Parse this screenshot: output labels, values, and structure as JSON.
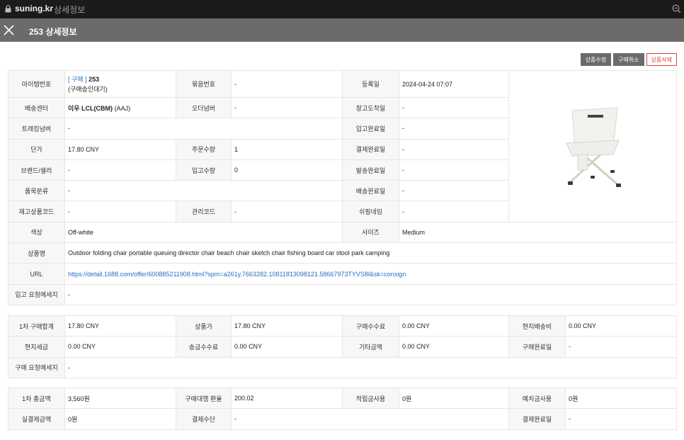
{
  "browser": {
    "host": "suning.kr",
    "subtitle": "상세정보"
  },
  "header": {
    "title": "253 상세정보"
  },
  "actions": {
    "edit": "상품수정",
    "cancel": "구매취소",
    "delete": "상품삭제"
  },
  "colors": {
    "header_bg": "#6b6b6b",
    "link": "#2b6cc4",
    "danger": "#e0453a"
  },
  "product": {
    "item_no_label": "아이템번호",
    "item_tag": "[ 구매 ]",
    "item_no": "253",
    "item_status": "(구매승인대기)",
    "bundle_label": "묶음번호",
    "bundle": "-",
    "reg_date_label": "등록일",
    "reg_date": "2024-04-24 07:07",
    "center_label": "배송센터",
    "center_name": "이우 LCL(CBM)",
    "center_code": "(AAJ)",
    "order_no_label": "오더넘버",
    "order_no": "-",
    "warehouse_arrival_label": "창고도착일",
    "warehouse_arrival": "-",
    "tracking_label": "트래킹넘버",
    "tracking": "-",
    "inbound_done_label": "입고완료일",
    "inbound_done": "-",
    "unit_price_label": "단가",
    "unit_price": "17.80 CNY",
    "order_qty_label": "주문수량",
    "order_qty": "1",
    "payment_done_label": "결제완료일",
    "payment_done": "-",
    "brand_label": "브랜드/셀러",
    "brand": "-",
    "inbound_qty_label": "입고수량",
    "inbound_qty": "0",
    "ship_done_label": "발송완료일",
    "ship_done": "-",
    "category_label": "품목분류",
    "category": "-",
    "delivery_done_label": "배송완료일",
    "delivery_done": "-",
    "stock_code_label": "재고상품코드",
    "stock_code": "-",
    "manage_code_label": "관리코드",
    "manage_code": "-",
    "shipping_name_label": "쉬핑네임",
    "shipping_name": "-",
    "color_label": "색상",
    "color": "Off-white",
    "size_label": "사이즈",
    "size": "Medium",
    "name_label": "상품명",
    "name": "Outdoor folding chair portable queuing director chair beach chair sketch chair fishing board car stool park camping",
    "url_label": "URL",
    "url": "https://detail.1688.com/offer/600885211908.html?spm=a261y.7663282.10811813098121.58667973TYVS8l&sk=consign",
    "inbound_msg_label": "입고 요청메세지",
    "inbound_msg": "-"
  },
  "purchase": {
    "total_label": "1차 구매합계",
    "total": "17.80 CNY",
    "goods_price_label": "상품가",
    "goods_price": "17.80 CNY",
    "fee_label": "구매수수료",
    "fee": "0.00 CNY",
    "local_ship_label": "현지배송비",
    "local_ship": "0.00 CNY",
    "local_tax_label": "현지세금",
    "local_tax": "0.00 CNY",
    "remit_fee_label": "송금수수료",
    "remit_fee": "0.00 CNY",
    "other_label": "기타금액",
    "other": "0.00 CNY",
    "purchase_done_label": "구매완료일",
    "purchase_done": "-",
    "msg_label": "구매 요청메세지",
    "msg": "-"
  },
  "payment": {
    "total_label": "1차 총금액",
    "total": "3,560원",
    "rate_label": "구매대행 환율",
    "rate": "200.02",
    "points_label": "적립금사용",
    "points": "0원",
    "deposit_label": "예치금사용",
    "deposit": "0원",
    "actual_label": "실결제금액",
    "actual": "0원",
    "method_label": "결제수단",
    "method": "-",
    "done_label": "결제완료일",
    "done": "-"
  }
}
